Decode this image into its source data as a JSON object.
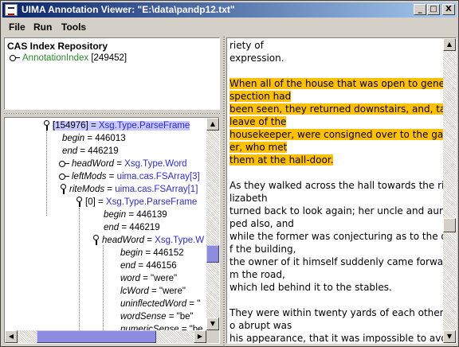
{
  "window": {
    "title": "UIMA Annotation Viewer: \"E:\\data\\pandp12.txt\"",
    "minimize_glyph": "_",
    "maximize_glyph": "□",
    "close_glyph": "X"
  },
  "menu": [
    "File",
    "Run",
    "Tools"
  ],
  "cas_panel": {
    "title": "CAS Index Repository",
    "index_name": "AnnotationIndex",
    "index_count": "[249452]"
  },
  "tree": {
    "rows": [
      {
        "id": "[154976]",
        "eq": " = ",
        "type": "Xsg.Type.ParseFrame"
      },
      {
        "field": "begin",
        "value": " = 446013"
      },
      {
        "field": "end",
        "value": " = 446219"
      },
      {
        "field": "headWord",
        "eq": " = ",
        "type": "Xsg.Type.Word"
      },
      {
        "field": "leftMods",
        "eq": " = ",
        "type": "uima.cas.FSArray[3]"
      },
      {
        "field": "riteMods",
        "eq": " = ",
        "type": "uima.cas.FSArray[1]"
      },
      {
        "id": "[0]",
        "eq": " = ",
        "type": "Xsg.Type.ParseFrame"
      },
      {
        "field": "begin",
        "value": " = 446139"
      },
      {
        "field": "end",
        "value": " = 446219"
      },
      {
        "field": "headWord",
        "eq": " = ",
        "type": "Xsg.Type.W"
      },
      {
        "field": "begin",
        "value": " = 446152"
      },
      {
        "field": "end",
        "value": " = 446156"
      },
      {
        "field": "word",
        "value": " = \"were\""
      },
      {
        "field": "lcWord",
        "value": " = \"were\""
      },
      {
        "field": "uninflectedWord",
        "value": " = \""
      },
      {
        "field": "wordSense",
        "value": " = \"be\""
      },
      {
        "field": "numericSense",
        "value": " = \"be"
      }
    ]
  },
  "document": {
    "lines": [
      {
        "text": "riety of",
        "hl": false
      },
      {
        "text": "expression.",
        "hl": false
      },
      {
        "text": "",
        "hl": false
      },
      {
        "text": "When all of the house that was open to general in",
        "hl": true
      },
      {
        "text": "spection had",
        "hl": true
      },
      {
        "text": "been seen, they returned downstairs, and, taking",
        "hl": true
      },
      {
        "text": "leave of the",
        "hl": true
      },
      {
        "text": "housekeeper, were consigned over to the garden",
        "hl": true
      },
      {
        "text": "er, who met",
        "hl": true
      },
      {
        "text": "them at the hall-door.",
        "hl": true
      },
      {
        "text": "",
        "hl": false
      },
      {
        "text": "As they walked across the hall towards the river, E",
        "hl": false
      },
      {
        "text": "lizabeth",
        "hl": false
      },
      {
        "text": "turned back to look again; her uncle and aunt stop",
        "hl": false
      },
      {
        "text": "ped also, and",
        "hl": false
      },
      {
        "text": "while the former was conjecturing as to the date o",
        "hl": false
      },
      {
        "text": "f the building,",
        "hl": false
      },
      {
        "text": "the owner of it himself suddenly came forward fro",
        "hl": false
      },
      {
        "text": "m the road,",
        "hl": false
      },
      {
        "text": "which led behind it to the stables.",
        "hl": false
      },
      {
        "text": "",
        "hl": false
      },
      {
        "text": "They were within twenty yards of each other, and s",
        "hl": false
      },
      {
        "text": "o abrupt was",
        "hl": false
      },
      {
        "text": "his appearance, that it was impossible to avoid hi",
        "hl": false
      }
    ]
  },
  "colors": {
    "highlight": "#ffc000",
    "type_link": "#2b2bd6",
    "index_link": "#2a8a2a"
  }
}
